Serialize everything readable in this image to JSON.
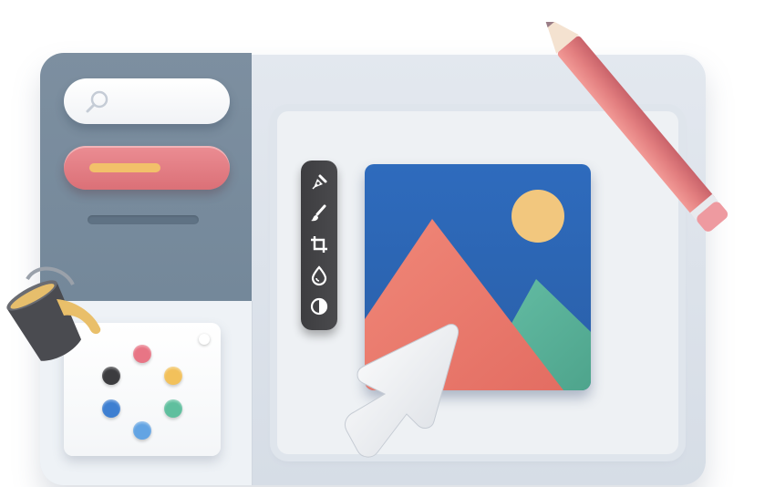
{
  "illustration": {
    "colors": {
      "sidebar": "#7d8fa0",
      "accent_pill": "#e38089",
      "pill_bar": "#f2c06a",
      "sky": "#2f6db8",
      "sun": "#f2c77e",
      "mountain_main": "#ef7f74",
      "mountain_small": "#5cb39c",
      "toolbar": "#424245",
      "pencil": "#e27e7f"
    }
  },
  "sidebar": {
    "search": {
      "icon": "search-icon",
      "placeholder": ""
    },
    "primary_button": {
      "icon": "pill-bar",
      "label": ""
    }
  },
  "palette": {
    "swatches": [
      {
        "name": "pink",
        "color": "#e87585"
      },
      {
        "name": "yellow",
        "color": "#f2c15b"
      },
      {
        "name": "teal",
        "color": "#5fbf9e"
      },
      {
        "name": "light-blue",
        "color": "#63a4e3"
      },
      {
        "name": "blue",
        "color": "#3e7fd1"
      },
      {
        "name": "black",
        "color": "#3c3c3f"
      }
    ]
  },
  "toolbar": {
    "tools": [
      {
        "name": "pen-tool-icon"
      },
      {
        "name": "brush-icon"
      },
      {
        "name": "crop-icon"
      },
      {
        "name": "drop-icon"
      },
      {
        "name": "contrast-icon"
      }
    ]
  },
  "objects": {
    "pencil": "pencil-icon",
    "bucket": "paint-bucket-icon",
    "cursor": "cursor-arrow-icon"
  }
}
